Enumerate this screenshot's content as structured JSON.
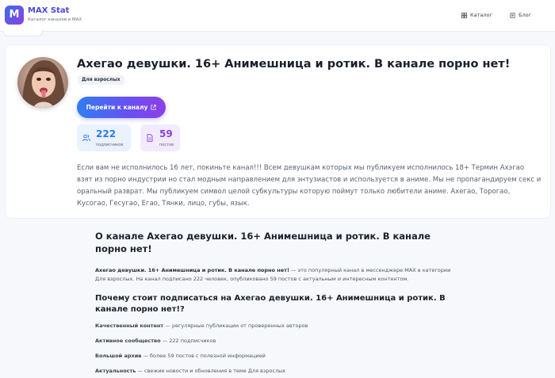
{
  "header": {
    "logo_letter": "M",
    "brand_title": "MAX Stat",
    "brand_subtitle": "Каталог каналов в MAX",
    "nav": [
      {
        "label": "Каталог",
        "icon": "grid-icon"
      },
      {
        "label": "Блог",
        "icon": "document-icon"
      }
    ]
  },
  "channel": {
    "title": "Ахегао девушки. 16+ Анимешница и ротик. В канале порно нет!",
    "tag": "Для взрослых",
    "go_button": "Перейти к каналу",
    "stats": {
      "subscribers_value": "222",
      "subscribers_label": "подписчиков",
      "posts_value": "59",
      "posts_label": "постов"
    },
    "description": "Если вам не исполнилось 16 лет, покиньте канал!!! Всем девушкам которых мы публикуем исполнилось 18+ Термин Ахэгао взят из порно индустрии но стал модным направлением для энтузиастов и используется в аниме. Мы не пропагандируем секс и оральный разврат. Мы публикуем символ целой субкультуры которую поймут только любители аниме. Ахегао, Торогао, Кусогао, Гесугао, Егао, Тянки, лицо, губы, язык."
  },
  "about": {
    "heading": "О канале Ахегао девушки. 16+ Анимешница и ротик. В канале порно нет!",
    "intro_bold": "Ахегао девушки. 16+ Анимешница и ротик. В канале порно нет!",
    "intro_rest": " — это популярный канал в мессенджере MAX в категории Для взрослых. На канал подписано 222 человек, опубликовано 59 постов с актуальным и интересным контентом.",
    "why_heading": "Почему стоит подписаться на Ахегао девушки. 16+ Анимешница и ротик. В канале порно нет!?",
    "features": [
      {
        "bold": "Качественный контент",
        "rest": " — регулярные публикации от проверенных авторов"
      },
      {
        "bold": "Активное сообщество",
        "rest": " — 222 подписчиков"
      },
      {
        "bold": "Большой архив",
        "rest": " — более 59 постов с полезной информацией"
      },
      {
        "bold": "Актуальность",
        "rest": " — свежие новости и обновления в теме Для взрослых"
      }
    ]
  },
  "colors": {
    "accent": "#4c49d8",
    "button_gradient_start": "#2f7ef2",
    "button_gradient_end": "#8d3fe6",
    "subscribers_color": "#2b7be8",
    "posts_color": "#8b3fe0"
  }
}
